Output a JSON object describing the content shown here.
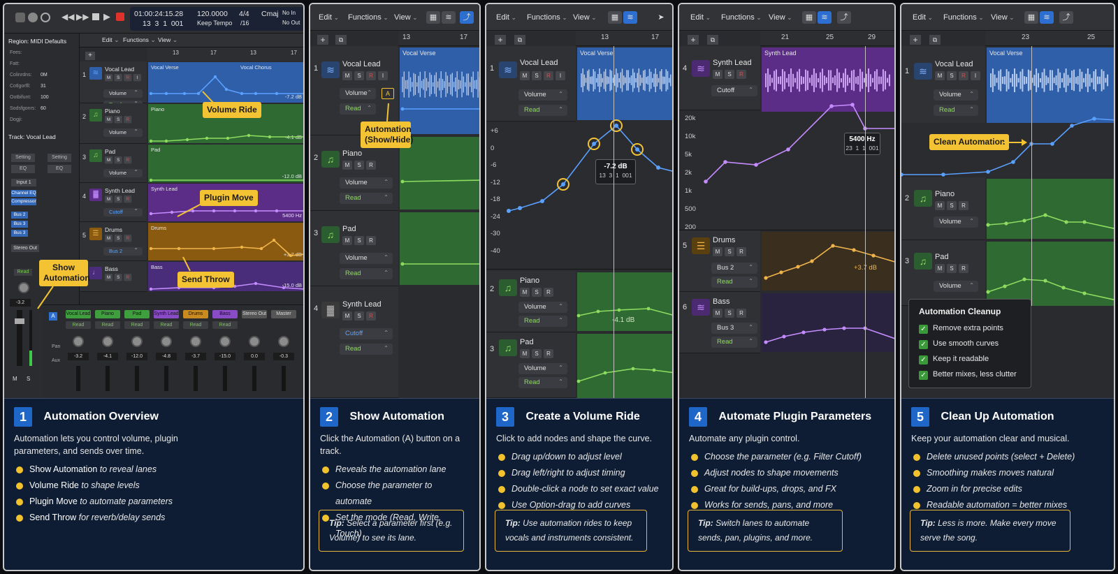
{
  "panels": [
    {
      "number": "1",
      "title": "Automation Overview",
      "intro": "Automation lets you control volume, plugin parameters, and sends over time.",
      "bullets": [
        {
          "bold": "Show Automation",
          "rest": " to reveal lanes"
        },
        {
          "bold": "Volume Ride",
          "rest": " to shape levels"
        },
        {
          "bold": "Plugin Move",
          "rest": " to automate parameters"
        },
        {
          "bold": "Send Throw",
          "rest": " for reverb/delay sends"
        }
      ]
    },
    {
      "number": "2",
      "title": "Show Automation",
      "intro": "Click the Automation (A) button on a track.",
      "bullets": [
        "Reveals the automation lane",
        "Choose the parameter to automate",
        "Set the mode (Read, Write, Touch)"
      ],
      "tip_label": "Tip:",
      "tip_text": "Select a parameter first (e.g. Volume) to see its lane."
    },
    {
      "number": "3",
      "title": "Create a Volume Ride",
      "intro": "Click to add nodes and shape the curve.",
      "bullets": [
        "Drag up/down to adjust level",
        "Drag left/right to adjust timing",
        "Double-click a node to set exact value",
        "Use Option-drag to add curves"
      ],
      "tip_label": "Tip:",
      "tip_text": "Use automation rides to keep vocals and instruments consistent."
    },
    {
      "number": "4",
      "title": "Automate Plugin Parameters",
      "intro": "Automate any plugin control.",
      "bullets": [
        "Choose the parameter (e.g. Filter Cutoff)",
        "Adjust nodes to shape movements",
        "Great for build-ups, drops, and FX",
        "Works for sends, pans, and more"
      ],
      "tip_label": "Tip:",
      "tip_text": "Switch lanes to automate sends, pan, plugins, and more."
    },
    {
      "number": "5",
      "title": "Clean Up Automation",
      "intro": "Keep your automation clear and musical.",
      "bullets": [
        "Delete unused points (select + Delete)",
        "Smoothing makes moves natural",
        "Zoom in for precise edits",
        "Readable automation = better mixes"
      ],
      "tip_label": "Tip:",
      "tip_text": "Less is more. Make every move serve the song."
    }
  ],
  "menus": {
    "edit": "Edit",
    "functions": "Functions",
    "view": "View"
  },
  "transport": {
    "position": "01:00:24:15.28",
    "bars": "13  3  1  001",
    "tempo": "120.0000",
    "tempo_label": "Keep Tempo",
    "signature": "4/4",
    "division": "/16",
    "key": "Cmaj",
    "no_in": "No In",
    "no_out": "No Out"
  },
  "inspector": {
    "region_label": "Region: MIDI Defaults",
    "track_label": "Track: Vocal Lead",
    "fields": [
      {
        "name": "Fees:",
        "value": ""
      },
      {
        "name": "Fatt:",
        "value": ""
      },
      {
        "name": "Colinrdns:",
        "value": "0M"
      },
      {
        "name": "Cotlgorfll:",
        "value": "31"
      },
      {
        "name": "Ootbifunt:",
        "value": "100"
      },
      {
        "name": "Sodsfgonrs:",
        "value": "60"
      },
      {
        "name": "Dogji:",
        "value": ""
      }
    ],
    "setting": "Setting",
    "eq": "EQ",
    "input": "Input 1",
    "plugins": [
      "Channel EQ",
      "Compressor"
    ],
    "buses": [
      "Bus 2",
      "Bus 3",
      "Bus 3"
    ],
    "stereo_out": "Stereo Out",
    "read": "Read",
    "value": "-3.2",
    "m": "M",
    "s": "S"
  },
  "p1_tracks": [
    {
      "num": "1",
      "name": "Vocal Lead",
      "param": "Volume",
      "mode": "Read",
      "region": "Vocal Verse",
      "region2": "Vocal Chorus",
      "value": "-7.2 dB"
    },
    {
      "num": "2",
      "name": "Piano",
      "param": "Volume",
      "region": "Piano",
      "value": "-4.1 dB"
    },
    {
      "num": "3",
      "name": "Pad",
      "param": "Volume",
      "region": "Pad",
      "value": "-12.0 dB"
    },
    {
      "num": "4",
      "name": "Synth Lead",
      "param": "Cutoff",
      "region": "Synth Lead",
      "value": "5400 Hz"
    },
    {
      "num": "5",
      "name": "Drums",
      "param": "Bus 2",
      "region": "Drums",
      "value": "+3.7 dB"
    },
    {
      "num": "6",
      "name": "Bass",
      "region": "Bass",
      "value": "-15.0 dB"
    }
  ],
  "p1_ruler": [
    "13",
    "17",
    "13",
    "17"
  ],
  "mixer": [
    {
      "name": "Vocal Lead",
      "mode": "Read",
      "value": "-3.2",
      "color": "#3f9f3f"
    },
    {
      "name": "Piano",
      "mode": "Read",
      "value": "-4.1",
      "color": "#3f9f3f"
    },
    {
      "name": "Pad",
      "mode": "Read",
      "value": "-12.0",
      "color": "#3f9f3f"
    },
    {
      "name": "Synth Lead",
      "mode": "Read",
      "value": "-4.8",
      "color": "#8a4bc7"
    },
    {
      "name": "Drums",
      "mode": "Read",
      "value": "-3.7",
      "color": "#c98a1f"
    },
    {
      "name": "Bass",
      "mode": "Read",
      "value": "-15.0",
      "color": "#8a4bc7"
    },
    {
      "name": "Stereo Out",
      "mode": "",
      "value": "0.0",
      "color": "#555"
    },
    {
      "name": "Master",
      "mode": "",
      "value": "-0.3",
      "color": "#555"
    }
  ],
  "mixer_labels": {
    "a": "A",
    "pan": "Pan",
    "aux": "Aux"
  },
  "callouts": {
    "volume_ride": "Volume Ride",
    "plugin_move": "Plugin Move",
    "show_automation": "Show Automation",
    "send_throw": "Send Throw",
    "automation_show_hide": "Automation (Show/Hide)",
    "clean_automation": "Clean Automation"
  },
  "p2": {
    "ruler": [
      "13",
      "17"
    ],
    "tracks": [
      {
        "num": "1",
        "name": "Vocal Lead",
        "param": "Volume",
        "mode": "Read",
        "region": "Vocal Verse",
        "a_button": "A"
      },
      {
        "num": "2",
        "name": "Piano",
        "param": "Volume",
        "mode": "Read"
      },
      {
        "num": "3",
        "name": "Pad",
        "param": "Volume",
        "mode": "Read"
      },
      {
        "num": "4",
        "name": "Synth Lead",
        "param": "Cutoff",
        "mode": "Read"
      }
    ]
  },
  "p3": {
    "ruler": [
      "13",
      "17"
    ],
    "track1": {
      "num": "1",
      "name": "Vocal Lead",
      "param": "Volume",
      "mode": "Read",
      "region": "Vocal Verse"
    },
    "y_axis": [
      "+6",
      "0",
      "-6",
      "-12",
      "-18",
      "-24",
      "-30",
      "-40"
    ],
    "tooltip_value": "-7.2 dB",
    "tooltip_pos": "13  3  1  001",
    "track2": {
      "num": "2",
      "name": "Piano",
      "param": "Volume",
      "mode": "Read",
      "value": "-4.1 dB"
    },
    "track3": {
      "num": "3",
      "name": "Pad",
      "param": "Volume",
      "mode": "Read"
    }
  },
  "p4": {
    "ruler": [
      "21",
      "25",
      "29"
    ],
    "track4": {
      "num": "4",
      "name": "Synth Lead",
      "param": "Cutoff",
      "region": "Synth Lead"
    },
    "y_axis": [
      "20k",
      "10k",
      "5k",
      "2k",
      "1k",
      "500",
      "200"
    ],
    "tooltip_value": "5400 Hz",
    "tooltip_pos": "23  1  1  001",
    "track5": {
      "num": "5",
      "name": "Drums",
      "param": "Bus 2",
      "mode": "Read",
      "value": "+3.7 dB"
    },
    "track6": {
      "num": "6",
      "name": "Bass",
      "param": "Bus 3",
      "mode": "Read"
    }
  },
  "p5": {
    "ruler": [
      "23",
      "25"
    ],
    "track1": {
      "num": "1",
      "name": "Vocal Lead",
      "param": "Volume",
      "mode": "Read",
      "region": "Vocal Verse"
    },
    "track2": {
      "num": "2",
      "name": "Piano",
      "param": "Volume"
    },
    "track3": {
      "num": "3",
      "name": "Pad",
      "param": "Volume"
    },
    "cleanup_title": "Automation Cleanup",
    "checklist": [
      "Remove extra points",
      "Use smooth curves",
      "Keep it readable",
      "Better mixes, less clutter"
    ]
  },
  "msr": {
    "m": "M",
    "s": "S",
    "r": "R",
    "i": "I"
  },
  "colors": {
    "vocal": "#2f5fa8",
    "piano": "#2f6a33",
    "pad": "#2f6a33",
    "synth": "#5b2d87",
    "drums": "#8a5a10",
    "bass": "#4a2d7a",
    "accent": "#f3c334",
    "card": "#0e1d33"
  },
  "icons": {
    "waveform": "waveform-icon",
    "note": "music-note-icon",
    "faders": "faders-icon",
    "guitar": "guitar-icon",
    "check": "checkmark-icon"
  }
}
